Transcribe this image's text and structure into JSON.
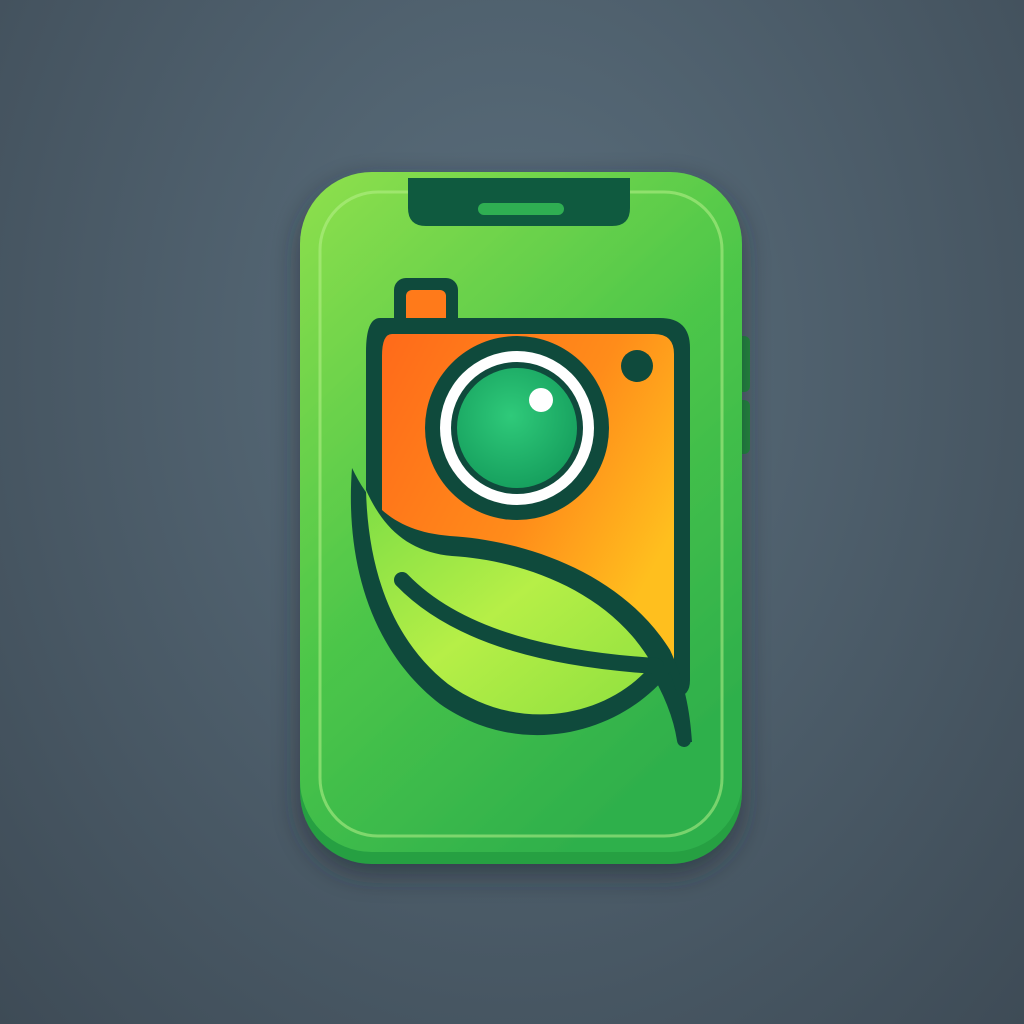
{
  "icon": {
    "name": "plant-camera-app-icon",
    "depicts": [
      "smartphone",
      "camera",
      "leaf"
    ]
  },
  "colors": {
    "background": "#4e5f6c",
    "phone_body": "#3fbf45",
    "phone_light": "#86e04a",
    "outline": "#0f4a3c",
    "camera_orange": "#ff7a1a",
    "camera_yellow": "#ffb21c",
    "lens_green": "#1fb06a",
    "lens_ring": "#ffffff",
    "leaf_light": "#b8f04a",
    "leaf_dark": "#63cf3b"
  }
}
